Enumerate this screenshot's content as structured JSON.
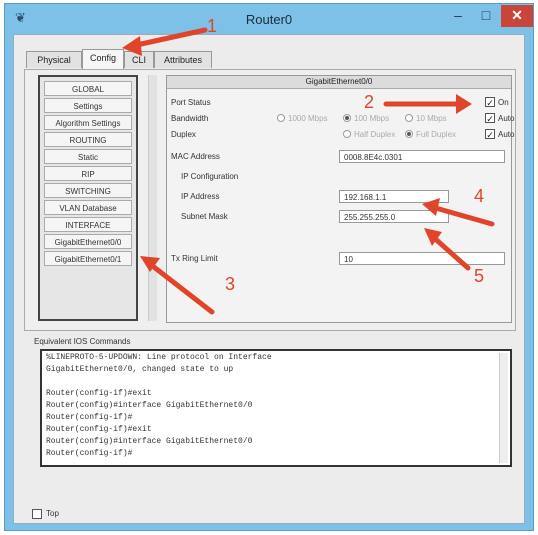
{
  "window": {
    "title": "Router0",
    "minimize_glyph": "–",
    "maximize_glyph": "□",
    "close_glyph": "✕"
  },
  "tabs": [
    "Physical",
    "Config",
    "CLI",
    "Attributes"
  ],
  "sidebar": {
    "items": [
      "GLOBAL",
      "Settings",
      "Algorithm Settings",
      "ROUTING",
      "Static",
      "RIP",
      "SWITCHING",
      "VLAN Database",
      "INTERFACE",
      "GigabitEthernet0/0",
      "GigabitEthernet0/1"
    ]
  },
  "config": {
    "interface_title": "GigabitEthernet0/0",
    "port_status_label": "Port Status",
    "port_status_on_label": "On",
    "bandwidth_label": "Bandwidth",
    "bandwidth_options": [
      "1000 Mbps",
      "100 Mbps",
      "10 Mbps"
    ],
    "bandwidth_auto_label": "Auto",
    "duplex_label": "Duplex",
    "duplex_options": [
      "Half Duplex",
      "Full Duplex"
    ],
    "duplex_auto_label": "Auto",
    "mac_label": "MAC Address",
    "mac_value": "0008.8E4c.0301",
    "ip_config_label": "IP Configuration",
    "ip_label": "IP Address",
    "ip_value": "192.168.1.1",
    "mask_label": "Subnet Mask",
    "mask_value": "255.255.255.0",
    "tx_ring_label": "Tx Ring Limit",
    "tx_ring_value": "10"
  },
  "console": {
    "label": "Equivalent IOS Commands",
    "lines": [
      "%LINEPROTO-5-UPDOWN: Line protocol on Interface",
      "GigabitEthernet0/0, changed state to up",
      "",
      "Router(config-if)#exit",
      "Router(config)#interface GigabitEthernet0/0",
      "Router(config-if)#",
      "Router(config-if)#exit",
      "Router(config)#interface GigabitEthernet0/0",
      "Router(config-if)#"
    ]
  },
  "footer": {
    "top_label": "Top"
  },
  "annotations": {
    "n1": "1",
    "n2": "2",
    "n3": "3",
    "n4": "4",
    "n5": "5",
    "color": "#e0452b"
  }
}
